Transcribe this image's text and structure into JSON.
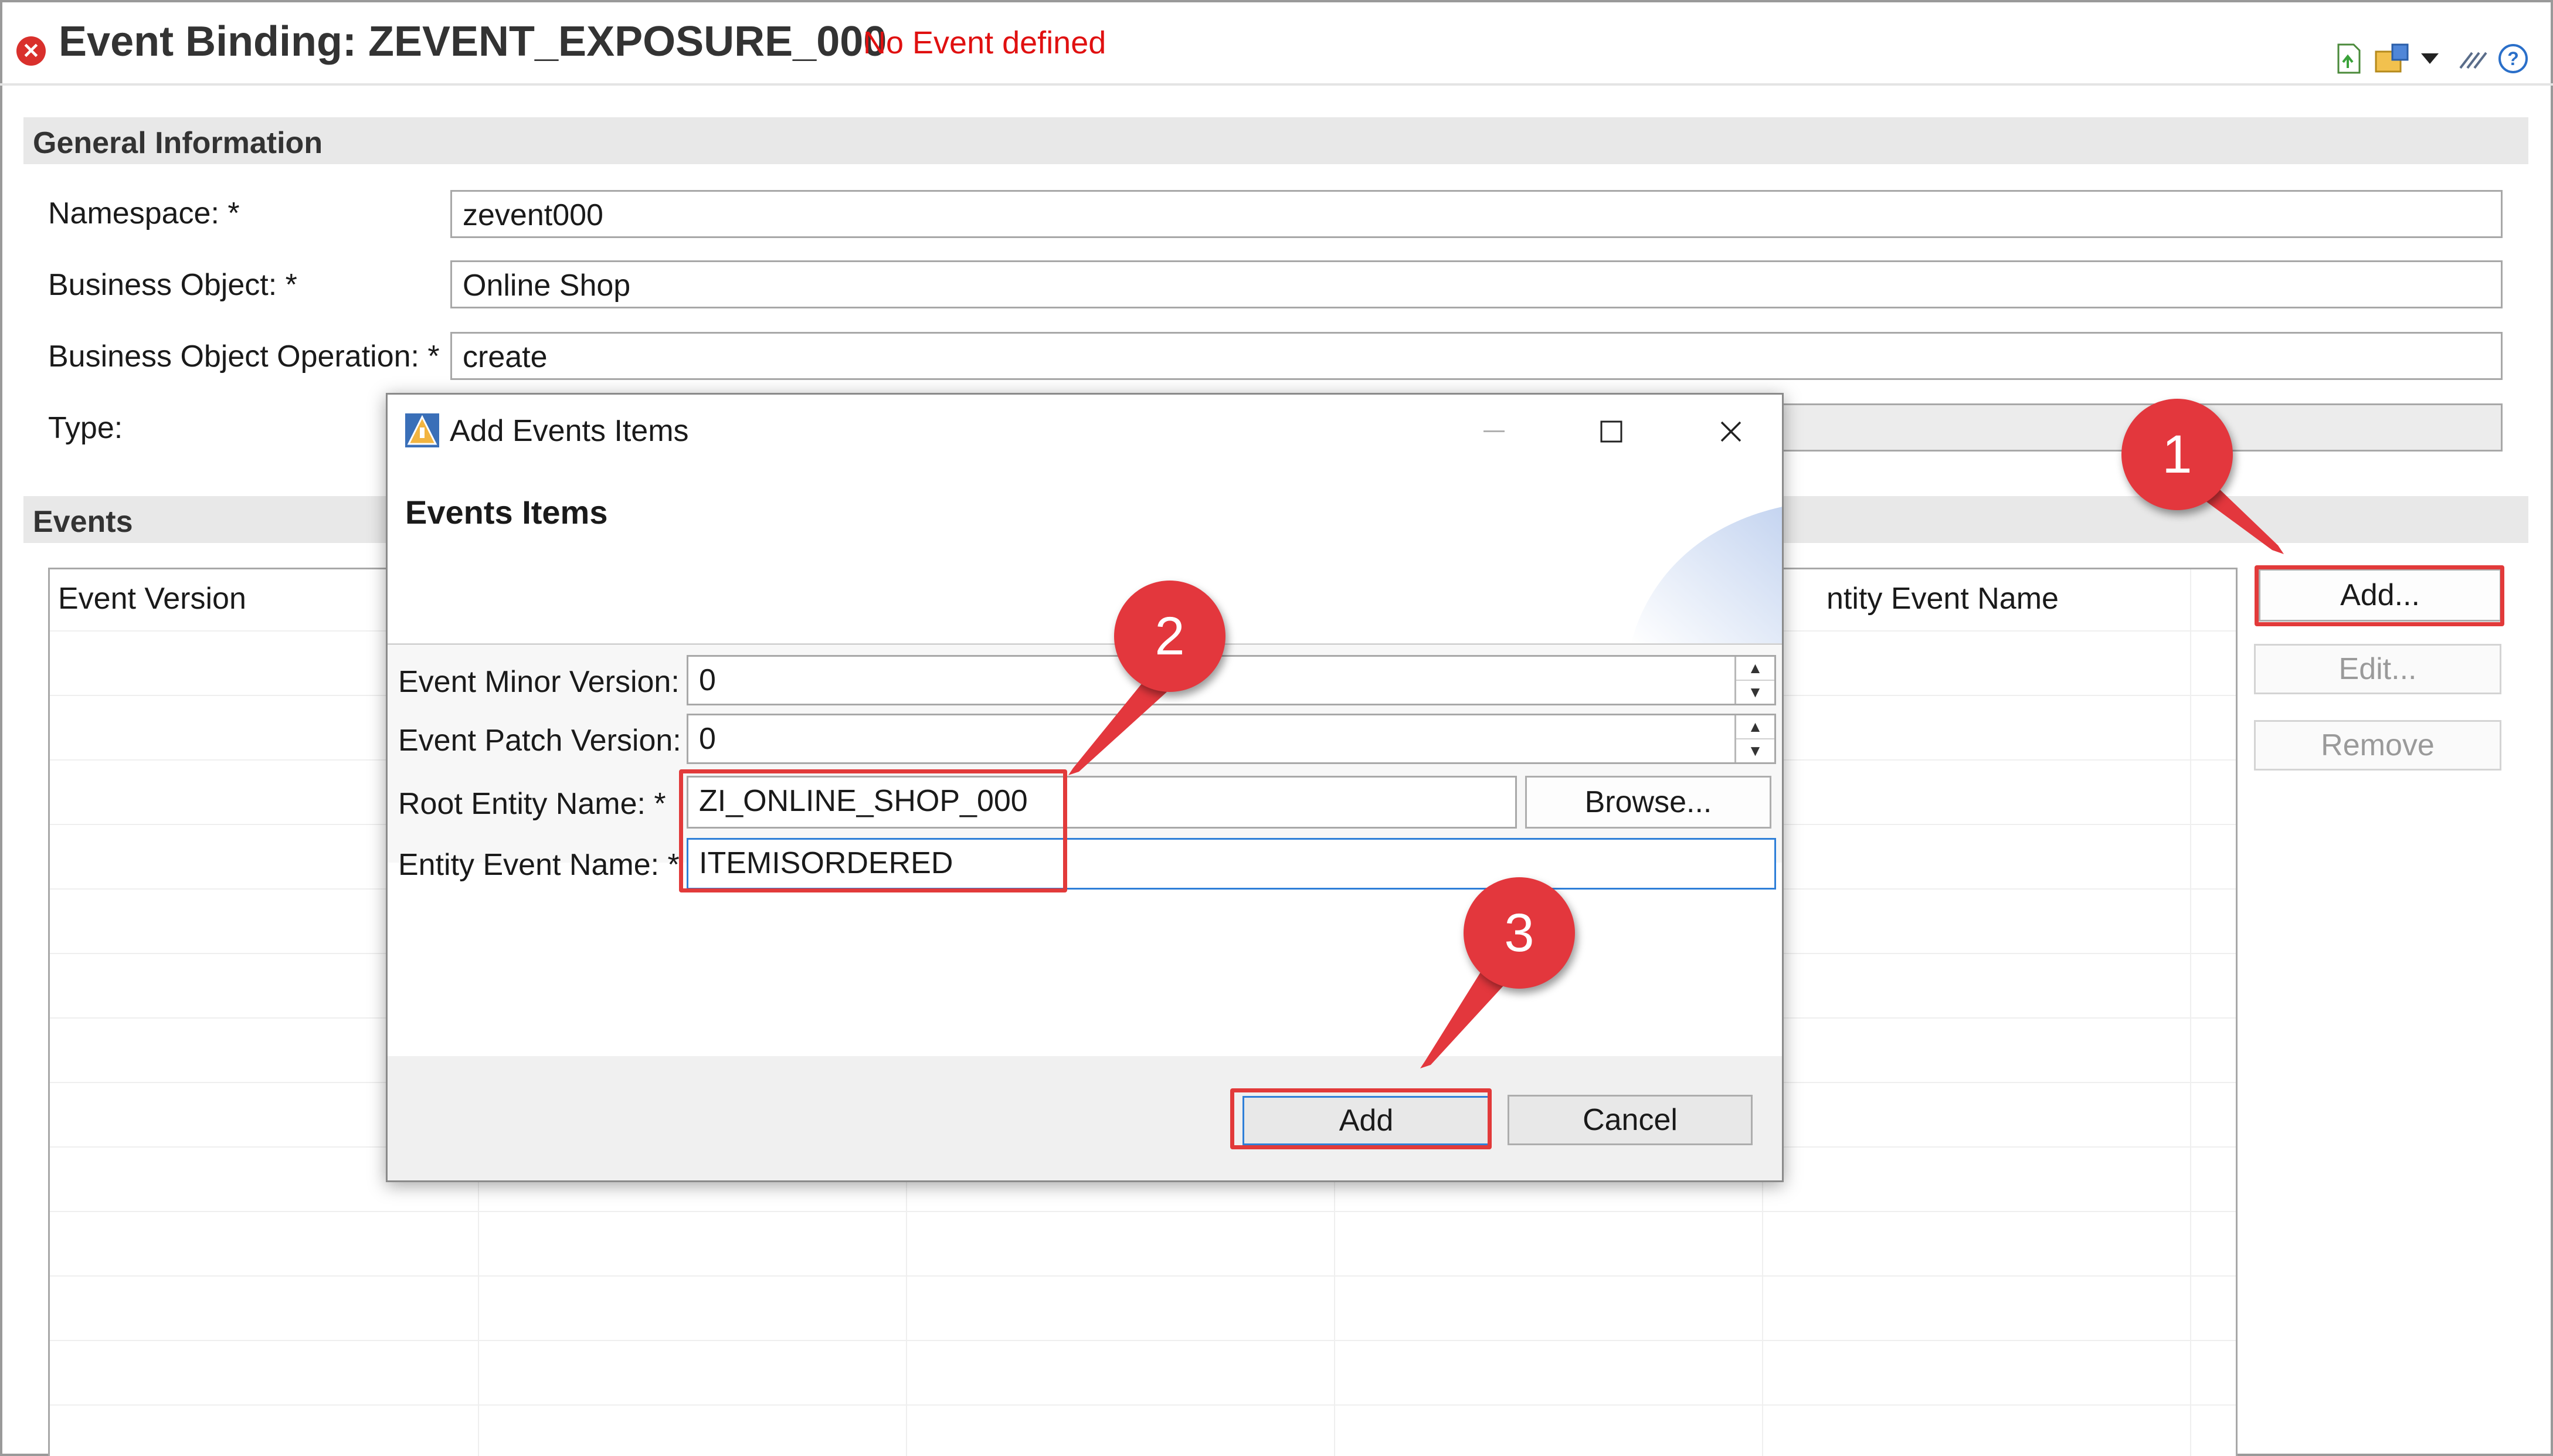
{
  "header": {
    "error_icon": "error-x-icon",
    "title": "Event Binding: ZEVENT_EXPOSURE_000",
    "status": "No Event defined",
    "toolbar_icons": [
      "export-icon",
      "share-icon",
      "dropdown-arrow-icon",
      "pin-icon",
      "help-icon"
    ]
  },
  "general": {
    "section_title": "General Information",
    "namespace_label": "Namespace: *",
    "namespace_value": "zevent000",
    "bo_label": "Business Object: *",
    "bo_value": "Online Shop",
    "bo_op_label": "Business Object Operation: *",
    "bo_op_value": "create",
    "type_label": "Type:",
    "type_value": ""
  },
  "events": {
    "section_title": "Events",
    "columns": [
      "Event Version",
      "ntity Event Name"
    ],
    "buttons": {
      "add": "Add...",
      "edit": "Edit...",
      "remove": "Remove"
    }
  },
  "dialog": {
    "title": "Add Events Items",
    "icon": "wizard-icon",
    "heading": "Events Items",
    "window_buttons": [
      "minimize-icon",
      "maximize-icon",
      "close-icon"
    ],
    "minor_label": "Event Minor Version:",
    "minor_value": "0",
    "patch_label": "Event Patch Version:",
    "patch_value": "0",
    "root_label": "Root Entity Name: *",
    "root_value": "ZI_ONLINE_SHOP_000",
    "browse_label": "Browse...",
    "entity_event_label": "Entity Event Name: *",
    "entity_event_value": "ITEMISORDERED",
    "add_label": "Add",
    "cancel_label": "Cancel"
  },
  "annotations": {
    "step1": "1",
    "step2": "2",
    "step3": "3",
    "color": "#e3373d"
  }
}
